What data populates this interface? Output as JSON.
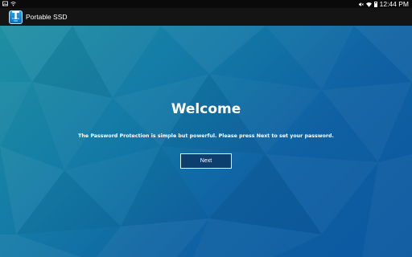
{
  "status_bar": {
    "time": "12:44 PM",
    "left_icons": [
      "photo-icon",
      "wifi-signal-icon"
    ],
    "right_icons": [
      "mute-icon",
      "wifi-icon",
      "battery-icon"
    ]
  },
  "action_bar": {
    "app_icon_letter": "T",
    "app_icon_caption": "Portable SSD",
    "app_title": "Portable SSD"
  },
  "main": {
    "title": "Welcome",
    "message": "The Password Protection is simple but powerful. Please press Next to set your password.",
    "next_label": "Next"
  },
  "colors": {
    "background_start": "#1f8fa2",
    "background_end": "#0b57a0",
    "button_fill": "#0c3f6e",
    "action_bar": "#141414"
  }
}
